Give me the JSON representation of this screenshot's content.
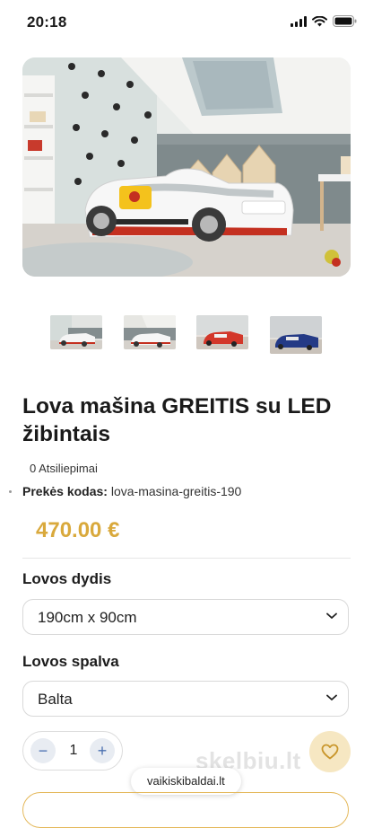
{
  "status": {
    "time": "20:18"
  },
  "product": {
    "title": "Lova mašina GREITIS su LED žibintais",
    "reviews": "0 Atsiliepimai",
    "sku_label": "Prekės kodas:",
    "sku_value": "lova-masina-greitis-190",
    "price": "470.00 €"
  },
  "options": {
    "size_label": "Lovos dydis",
    "size_value": "190cm x 90cm",
    "color_label": "Lovos spalva",
    "color_value": "Balta"
  },
  "quantity": {
    "minus": "−",
    "value": "1",
    "plus": "+"
  },
  "watermark": "skelbiu.lt",
  "site_pill": "vaikiskibaldai.lt",
  "colors": {
    "accent_gold": "#d9a93c",
    "qty_blue": "#4a6fb0"
  },
  "icons": [
    "signal-icon",
    "wifi-icon",
    "battery-icon",
    "chevron-down-icon",
    "heart-icon"
  ]
}
